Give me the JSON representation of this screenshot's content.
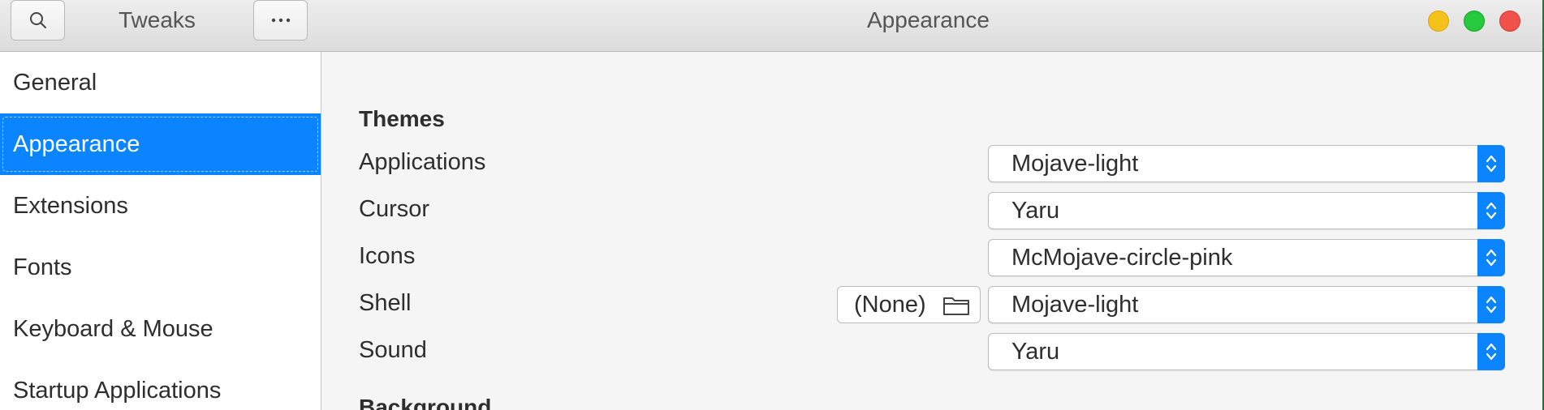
{
  "titlebar": {
    "app_name": "Tweaks",
    "window_title": "Appearance",
    "search_icon": "search-icon",
    "menu_icon": "ellipsis-icon"
  },
  "sidebar": {
    "items": [
      {
        "label": "General",
        "selected": false
      },
      {
        "label": "Appearance",
        "selected": true
      },
      {
        "label": "Extensions",
        "selected": false
      },
      {
        "label": "Fonts",
        "selected": false
      },
      {
        "label": "Keyboard & Mouse",
        "selected": false
      },
      {
        "label": "Startup Applications",
        "selected": false
      }
    ]
  },
  "themes": {
    "title": "Themes",
    "applications": {
      "label": "Applications",
      "value": "Mojave-light"
    },
    "cursor": {
      "label": "Cursor",
      "value": "Yaru"
    },
    "icons": {
      "label": "Icons",
      "value": "McMojave-circle-pink"
    },
    "shell": {
      "label": "Shell",
      "value": "Mojave-light",
      "file_button": "(None)"
    },
    "sound": {
      "label": "Sound",
      "value": "Yaru"
    }
  },
  "background": {
    "title": "Background"
  },
  "colors": {
    "accent": "#0a84ff",
    "close": "#f0524b",
    "minimize": "#f5c21b",
    "maximize": "#27c93f"
  }
}
